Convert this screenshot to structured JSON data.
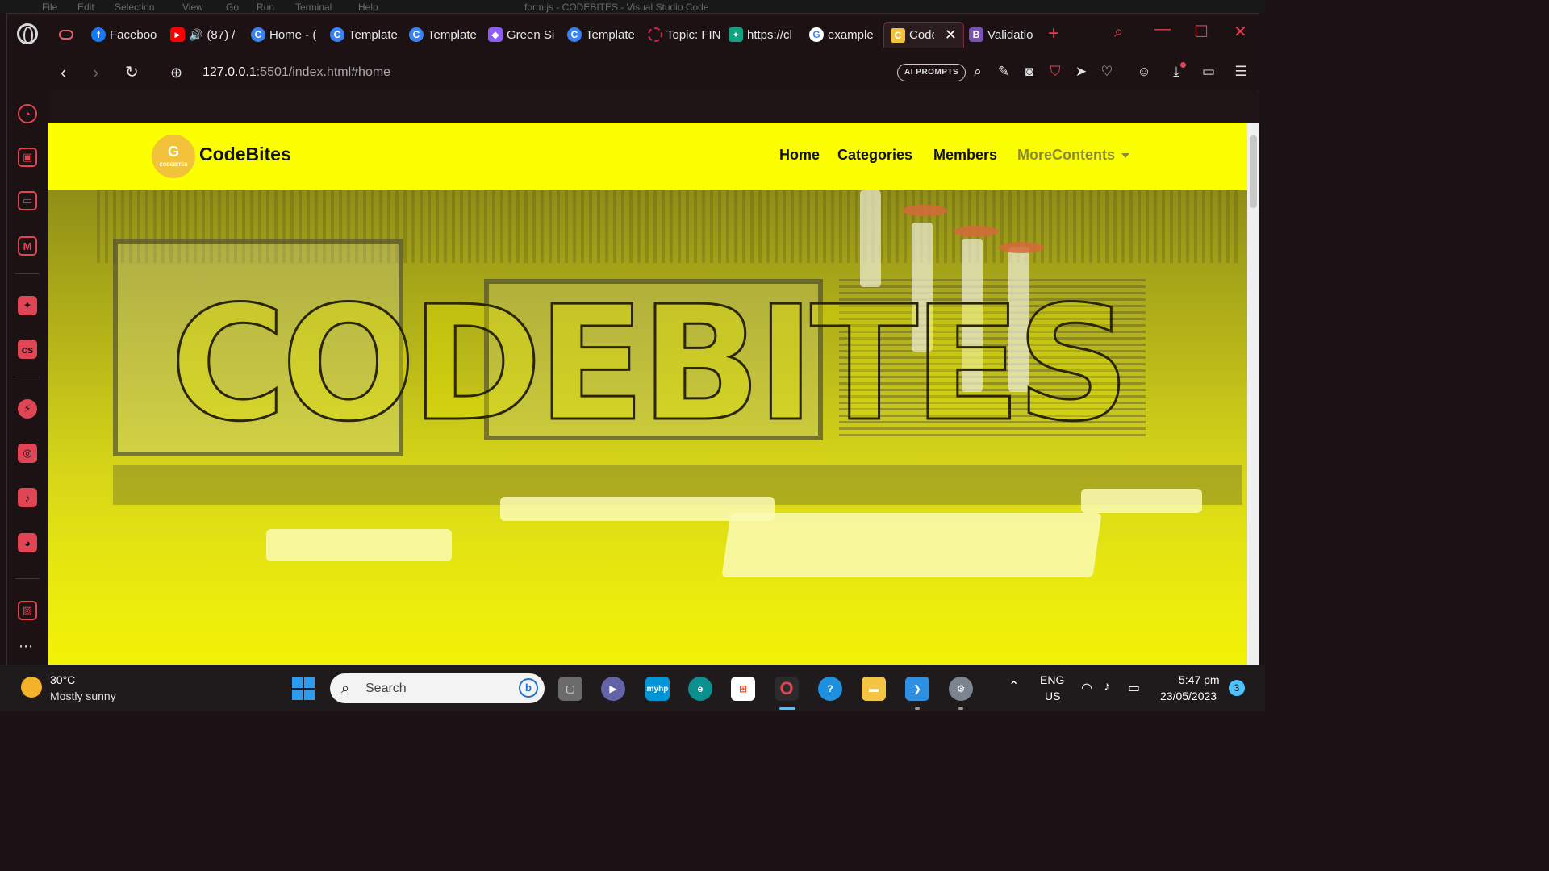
{
  "vscode_menu": [
    "File",
    "Edit",
    "Selection",
    "View",
    "Go",
    "Run",
    "Terminal",
    "Help"
  ],
  "vscode_title": "form.js - CODEBITES - Visual Studio Code",
  "browser": {
    "tabs": [
      {
        "label": "Faceboo",
        "icon": "facebook-icon",
        "color": "#1877f2",
        "glyph": "f"
      },
      {
        "label": "(87) /",
        "icon": "youtube-icon",
        "color": "#ff0000",
        "glyph": "▶"
      },
      {
        "label": "Home - (",
        "icon": "canva-icon",
        "color": "#3b82f6",
        "glyph": "C"
      },
      {
        "label": "Template",
        "icon": "canva-icon",
        "color": "#3b82f6",
        "glyph": "C"
      },
      {
        "label": "Template",
        "icon": "canva-icon",
        "color": "#3b82f6",
        "glyph": "C"
      },
      {
        "label": "Green Si",
        "icon": "figma-icon",
        "color": "#8b5cf6",
        "glyph": "◆"
      },
      {
        "label": "Template",
        "icon": "canva-icon",
        "color": "#3b82f6",
        "glyph": "C"
      },
      {
        "label": "Topic: FIN",
        "icon": "topic-icon",
        "color": "#e11d48",
        "glyph": "○"
      },
      {
        "label": "https://cl",
        "icon": "chatgpt-icon",
        "color": "#10a37f",
        "glyph": "✦"
      },
      {
        "label": "example",
        "icon": "google-icon",
        "color": "#4285f4",
        "glyph": "G"
      },
      {
        "label": "Code",
        "icon": "codebites-favicon-icon",
        "color": "#f2c23a",
        "glyph": "C",
        "active": true
      },
      {
        "label": "Validatio",
        "icon": "bootstrap-icon",
        "color": "#7952b3",
        "glyph": "B"
      }
    ],
    "url_host": "127.0.0.1",
    "url_rest": ":5501/index.html#home",
    "ai_prompts_label": "AI PROMPTS"
  },
  "site": {
    "logo_text": "CodeBites",
    "logo_small": "CODEBITES",
    "nav": [
      "Home",
      "Categories",
      "Members",
      "MoreContents"
    ],
    "hero_title": "CODEBITES"
  },
  "taskbar": {
    "temperature": "30°C",
    "weather": "Mostly sunny",
    "search_label": "Search",
    "lang_top": "ENG",
    "lang_bottom": "US",
    "time": "5:47 pm",
    "date": "23/05/2023",
    "notification_count": "3",
    "apps": [
      {
        "name": "task-view-icon",
        "color": "#6b6b6b"
      },
      {
        "name": "teams-icon",
        "color": "#6264a7"
      },
      {
        "name": "myhp-icon",
        "color": "#0096d6"
      },
      {
        "name": "edge-icon",
        "color": "#0c8f8f"
      },
      {
        "name": "store-icon",
        "color": "#f25022"
      },
      {
        "name": "opera-icon",
        "color": "#e04555"
      },
      {
        "name": "help-icon",
        "color": "#1f8fe0"
      },
      {
        "name": "explorer-icon",
        "color": "#f5c445"
      },
      {
        "name": "vscode-icon",
        "color": "#2f8fe0"
      },
      {
        "name": "settings-icon",
        "color": "#7a8590"
      }
    ]
  }
}
